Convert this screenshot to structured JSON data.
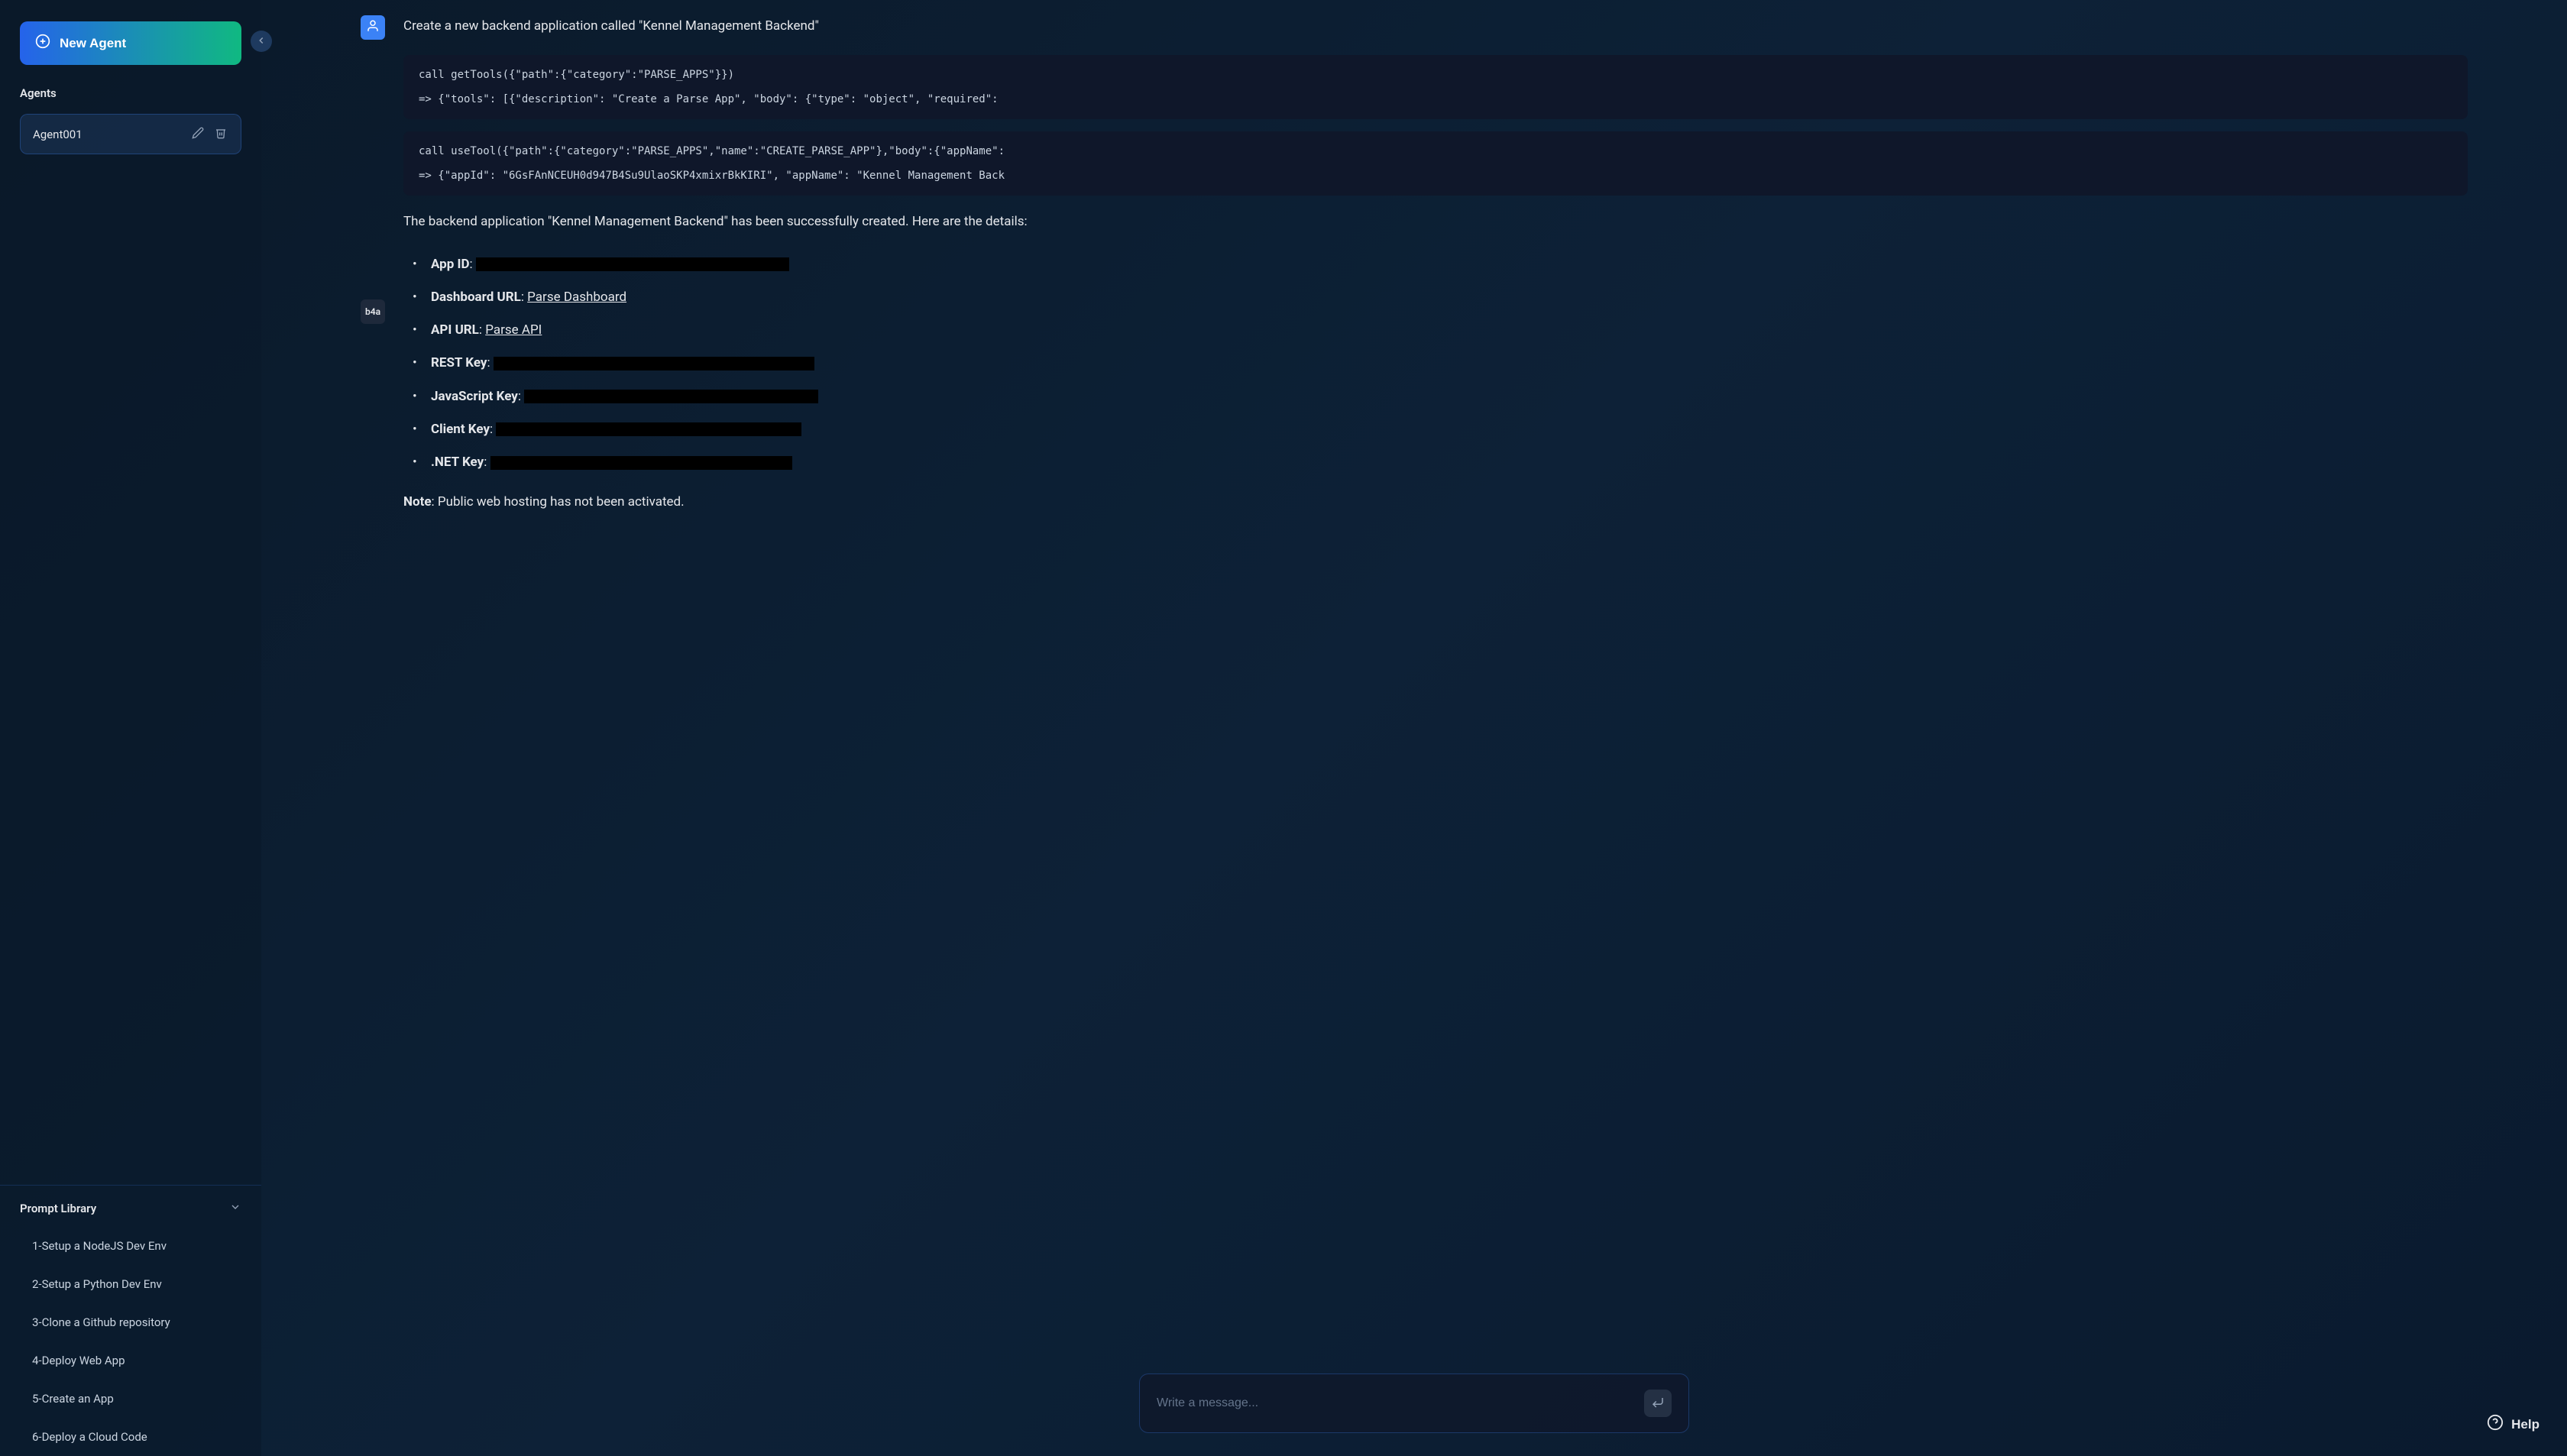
{
  "sidebar": {
    "new_agent_label": "New Agent",
    "agents_title": "Agents",
    "agents": [
      {
        "name": "Agent001"
      }
    ],
    "prompt_library_title": "Prompt Library",
    "prompts": [
      "1-Setup a NodeJS Dev Env",
      "2-Setup a Python Dev Env",
      "3-Clone a Github repository",
      "4-Deploy Web App",
      "5-Create an App",
      "6-Deploy a Cloud Code"
    ]
  },
  "chat": {
    "user_message": "Create a new backend application called \"Kennel Management Backend\"",
    "code_block_1_line1": "call getTools({\"path\":{\"category\":\"PARSE_APPS\"}})",
    "code_block_1_line2": "=> {\"tools\": [{\"description\": \"Create a Parse App\", \"body\": {\"type\": \"object\", \"required\":",
    "code_block_2_line1": "call useTool({\"path\":{\"category\":\"PARSE_APPS\",\"name\":\"CREATE_PARSE_APP\"},\"body\":{\"appName\":",
    "code_block_2_line2": "=> {\"appId\": \"6GsFAnNCEUH0d947B4Su9UlaoSKP4xmixrBkKIRI\", \"appName\": \"Kennel Management Back",
    "success_text": "The backend application \"Kennel Management Backend\" has been successfully created. Here are the details:",
    "details": {
      "app_id_label": "App ID",
      "dashboard_url_label": "Dashboard URL",
      "dashboard_url_link": "Parse Dashboard",
      "api_url_label": "API URL",
      "api_url_link": "Parse API",
      "rest_key_label": "REST Key",
      "javascript_key_label": "JavaScript Key",
      "client_key_label": "Client Key",
      "dotnet_key_label": ".NET Key"
    },
    "note_label": "Note",
    "note_text": ": Public web hosting has not been activated.",
    "b4a_label": "b4a"
  },
  "input": {
    "placeholder": "Write a message..."
  },
  "help_label": "Help"
}
